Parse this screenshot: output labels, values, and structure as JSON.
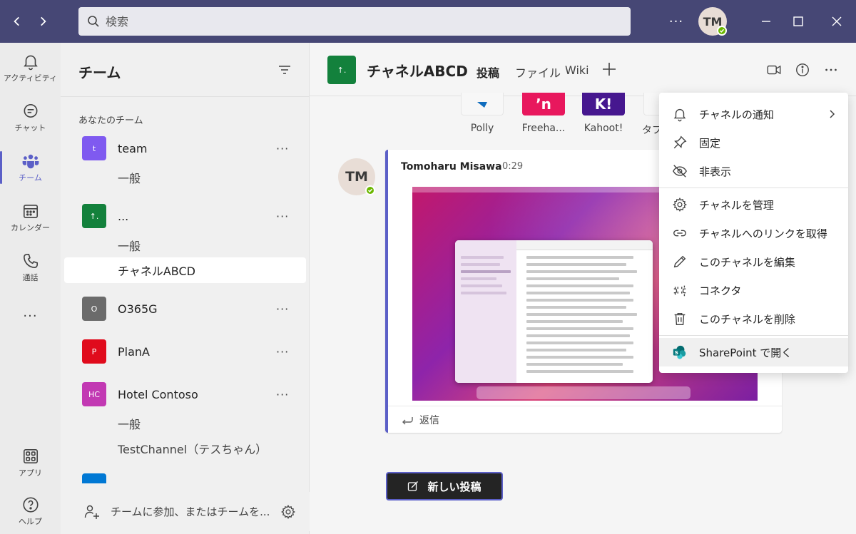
{
  "titlebar": {
    "search_placeholder": "検索",
    "more": "···",
    "avatar_initials": "TM"
  },
  "rail": {
    "items": [
      {
        "label": "アクティビティ"
      },
      {
        "label": "チャット"
      },
      {
        "label": "チーム"
      },
      {
        "label": "カレンダー"
      },
      {
        "label": "通話"
      },
      {
        "label": "···"
      },
      {
        "label": "アプリ"
      },
      {
        "label": "ヘルプ"
      }
    ]
  },
  "panel": {
    "title": "チーム",
    "section_label": "あなたのチーム",
    "teams": [
      {
        "initial": "t",
        "name": "team",
        "color": "#7f5af0",
        "channels": [
          "一般"
        ]
      },
      {
        "initial": "↑.",
        "name": "...",
        "color": "#13813c",
        "channels": [
          "一般",
          "チャネルABCD"
        ]
      },
      {
        "initial": "O",
        "name": "O365G",
        "color": "#6b6b6b",
        "channels": []
      },
      {
        "initial": "P",
        "name": "PlanA",
        "color": "#e00b1c",
        "channels": []
      },
      {
        "initial": "HC",
        "name": "Hotel Contoso",
        "color": "#c239b3",
        "channels": [
          "一般",
          "TestChannel（テスちゃん）"
        ]
      }
    ],
    "more": "···",
    "footer_text": "チームに参加、またはチームを..."
  },
  "channel": {
    "tile": "↑.",
    "name": "チャネルABCD",
    "tabs": [
      "投稿",
      "ファイル",
      "Wiki"
    ]
  },
  "apps": [
    {
      "name": "Polly",
      "color": "#ffffff",
      "glyph": "",
      "bg": "#f7f7f7"
    },
    {
      "name": "Freeha...",
      "color": "#ffffff",
      "glyph": "ʼn",
      "bg": "#e8175d"
    },
    {
      "name": "Kahoot!",
      "color": "#ffffff",
      "glyph": "K!",
      "bg": "#46178f"
    },
    {
      "name": "タブ",
      "color": "#ffffff",
      "glyph": "",
      "bg": "#f7f7f7"
    }
  ],
  "message": {
    "avatar_initials": "TM",
    "author": "Tomoharu Misawa",
    "time": "0:29",
    "reply": "返信"
  },
  "new_post": "新しい投稿",
  "menu": {
    "items": [
      {
        "label": "チャネルの通知"
      },
      {
        "label": "固定"
      },
      {
        "label": "非表示"
      },
      {
        "label": "チャネルを管理"
      },
      {
        "label": "チャネルへのリンクを取得"
      },
      {
        "label": "このチャネルを編集"
      },
      {
        "label": "コネクタ"
      },
      {
        "label": "このチャネルを削除"
      },
      {
        "label": "SharePoint で開く"
      }
    ]
  },
  "colors": {
    "titlebar": "#464775",
    "accent": "#5b5fc7",
    "presence": "#6bb700"
  }
}
